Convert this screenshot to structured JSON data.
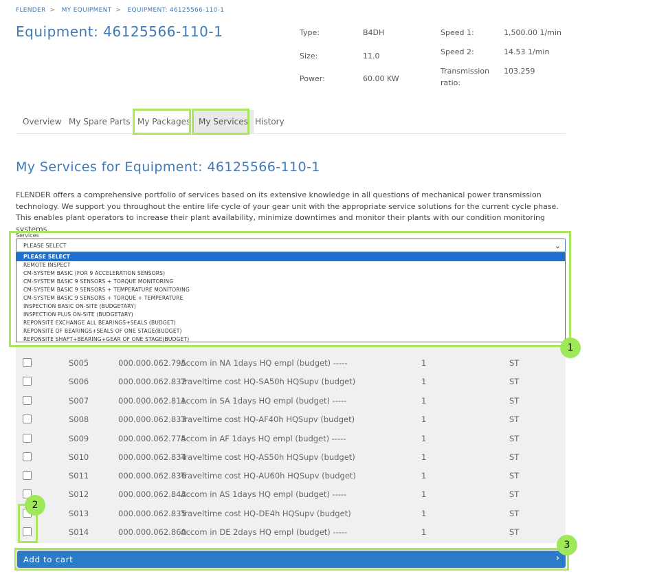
{
  "breadcrumb": [
    "FLENDER",
    "MY EQUIPMENT",
    "EQUIPMENT: 46125566-110-1"
  ],
  "breadcrumb_sep": ">",
  "page_title": "Equipment: 46125566-110-1",
  "specs": {
    "type_label": "Type:",
    "type_value": "B4DH",
    "size_label": "Size:",
    "size_value": "11.0",
    "power_label": "Power:",
    "power_value": "60.00 KW",
    "speed1_label": "Speed 1:",
    "speed1_value": "1,500.00 1/min",
    "speed2_label": "Speed 2:",
    "speed2_value": "14.53 1/min",
    "ratio_label_1": "Transmission",
    "ratio_label_2": "ratio:",
    "ratio_value": "103.259"
  },
  "tabs": [
    "Overview",
    "My Spare Parts",
    "My Packages",
    "My Services",
    "History"
  ],
  "active_tab": "My Services",
  "section_title": "My Services for Equipment: 46125566-110-1",
  "intro_text": "FLENDER offers a comprehensive portfolio of services based on its extensive knowledge in all questions of mechanical power transmission technology. We support you throughout the entire life cycle of your gear unit with the appropriate service solutions for the current cycle phase. This enables plant operators to increase their plant availability, minimize downtimes and monitor their plants with our condition monitoring systems.",
  "services": {
    "label": "Services",
    "selected": "PLEASE SELECT",
    "options": [
      "PLEASE SELECT",
      "REMOTE INSPECT",
      "CM-SYSTEM BASIC (FOR 9 ACCELERATION SENSORS)",
      "CM-SYSTEM BASIC 9 SENSORS + TORQUE MONITORING",
      "CM-SYSTEM BASIC 9 SENSORS + TEMPERATURE MONITORING",
      "CM-SYSTEM BASIC 9 SENSORS + TORQUE + TEMPERATURE",
      "INSPECTION BASIC ON-SITE (BUDGETARY)",
      "INSPECTION PLUS ON-SITE (BUDGETARY)",
      "REPONSITE EXCHANGE ALL BEARINGS+SEALS (BUDGET)",
      "REPONSITE OF BEARINGS+SEALS OF ONE STAGE(BUDGET)",
      "REPONSITE SHAFT+BEARING+GEAR OF ONE STAGE(BUDGET)"
    ]
  },
  "rows": [
    {
      "code": "S005",
      "num": "000.000.062.795",
      "desc": "Accom in NA 1days HQ empl (budget) -----",
      "qty": "1",
      "unit": "ST"
    },
    {
      "code": "S006",
      "num": "000.000.062.832",
      "desc": "Traveltime cost HQ-SA50h HQSupv (budget)",
      "qty": "1",
      "unit": "ST"
    },
    {
      "code": "S007",
      "num": "000.000.062.811",
      "desc": "Accom in SA 1days HQ empl (budget) -----",
      "qty": "1",
      "unit": "ST"
    },
    {
      "code": "S008",
      "num": "000.000.062.833",
      "desc": "Traveltime cost HQ-AF40h HQSupv (budget)",
      "qty": "1",
      "unit": "ST"
    },
    {
      "code": "S009",
      "num": "000.000.062.775",
      "desc": "Accom in AF 1days HQ empl (budget) -----",
      "qty": "1",
      "unit": "ST"
    },
    {
      "code": "S010",
      "num": "000.000.062.834",
      "desc": "Traveltime cost HQ-AS50h HQSupv (budget)",
      "qty": "1",
      "unit": "ST"
    },
    {
      "code": "S011",
      "num": "000.000.062.836",
      "desc": "Traveltime cost HQ-AU60h HQSupv (budget)",
      "qty": "1",
      "unit": "ST"
    },
    {
      "code": "S012",
      "num": "000.000.062.843",
      "desc": "Accom in AS 1days HQ empl (budget) -----",
      "qty": "1",
      "unit": "ST"
    },
    {
      "code": "S013",
      "num": "000.000.062.835",
      "desc": "Traveltime cost HQ-DE4h HQSupv (budget)",
      "qty": "1",
      "unit": "ST"
    },
    {
      "code": "S014",
      "num": "000.000.062.860",
      "desc": "Accom in DE 2days HQ empl (budget) -----",
      "qty": "1",
      "unit": "ST"
    }
  ],
  "cart_button": "Add to cart",
  "markers": [
    "1",
    "2",
    "3"
  ],
  "colors": {
    "accent": "#3f7ab5",
    "button": "#2c7bc6",
    "highlight": "#a8e85a",
    "selected_option": "#1f6fd1"
  }
}
